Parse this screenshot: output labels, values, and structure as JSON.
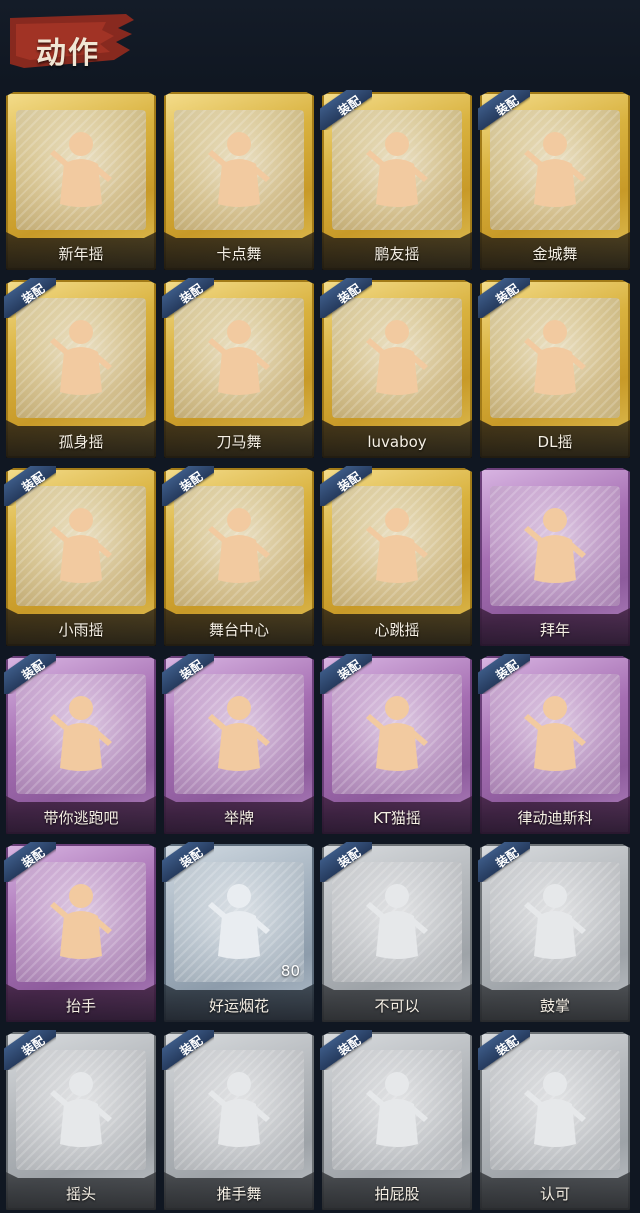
{
  "header": {
    "title": "动作"
  },
  "badge_label": "装配",
  "colors": {
    "gold": "#d9b23f",
    "purple": "#a66fb3",
    "blue": "#a4b2bf",
    "gray": "#b3b7bb",
    "background": "#101722"
  },
  "actions": [
    {
      "label": "新年摇",
      "rarity": "gold",
      "equipped": false,
      "icon": "dance-figure-icon"
    },
    {
      "label": "卡点舞",
      "rarity": "gold",
      "equipped": false,
      "icon": "dance-figure-icon"
    },
    {
      "label": "鹏友摇",
      "rarity": "gold",
      "equipped": true,
      "icon": "dance-figure-icon"
    },
    {
      "label": "金城舞",
      "rarity": "gold",
      "equipped": true,
      "icon": "dance-figure-icon"
    },
    {
      "label": "孤身摇",
      "rarity": "gold",
      "equipped": true,
      "icon": "dance-figure-icon"
    },
    {
      "label": "刀马舞",
      "rarity": "gold",
      "equipped": true,
      "icon": "dance-figure-icon"
    },
    {
      "label": "luvaboy",
      "rarity": "gold",
      "equipped": true,
      "icon": "dance-figure-icon"
    },
    {
      "label": "DL摇",
      "rarity": "gold",
      "equipped": true,
      "icon": "dance-figure-icon"
    },
    {
      "label": "小雨摇",
      "rarity": "gold",
      "equipped": true,
      "icon": "dance-figure-icon"
    },
    {
      "label": "舞台中心",
      "rarity": "gold",
      "equipped": true,
      "icon": "dance-figure-icon"
    },
    {
      "label": "心跳摇",
      "rarity": "gold",
      "equipped": true,
      "icon": "dance-figure-icon"
    },
    {
      "label": "拜年",
      "rarity": "purple",
      "equipped": false,
      "icon": "greeting-figure-icon"
    },
    {
      "label": "带你逃跑吧",
      "rarity": "purple",
      "equipped": true,
      "icon": "dance-figure-icon"
    },
    {
      "label": "举牌",
      "rarity": "purple",
      "equipped": true,
      "icon": "sign-figure-icon"
    },
    {
      "label": "KT猫摇",
      "rarity": "purple",
      "equipped": true,
      "icon": "dance-figure-icon"
    },
    {
      "label": "律动迪斯科",
      "rarity": "purple",
      "equipped": true,
      "icon": "dance-figure-icon"
    },
    {
      "label": "抬手",
      "rarity": "purple",
      "equipped": true,
      "icon": "raise-hand-icon"
    },
    {
      "label": "好运烟花",
      "rarity": "blue",
      "equipped": true,
      "icon": "firework-icon",
      "count": "80"
    },
    {
      "label": "不可以",
      "rarity": "gray",
      "equipped": true,
      "icon": "finger-wag-icon"
    },
    {
      "label": "鼓掌",
      "rarity": "gray",
      "equipped": true,
      "icon": "clap-icon"
    },
    {
      "label": "摇头",
      "rarity": "gray",
      "equipped": true,
      "icon": "shake-head-icon"
    },
    {
      "label": "推手舞",
      "rarity": "gray",
      "equipped": true,
      "icon": "push-hand-icon"
    },
    {
      "label": "拍屁股",
      "rarity": "gray",
      "equipped": true,
      "icon": "pat-icon"
    },
    {
      "label": "认可",
      "rarity": "gray",
      "equipped": true,
      "icon": "thumbs-up-icon"
    }
  ]
}
